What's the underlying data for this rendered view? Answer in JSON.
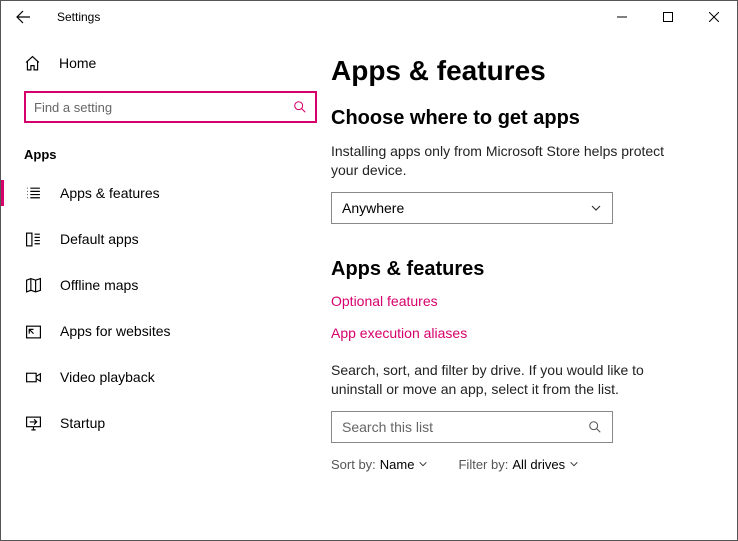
{
  "titlebar": {
    "title": "Settings"
  },
  "sidebar": {
    "home_label": "Home",
    "search_placeholder": "Find a setting",
    "group_label": "Apps",
    "items": [
      {
        "label": "Apps & features"
      },
      {
        "label": "Default apps"
      },
      {
        "label": "Offline maps"
      },
      {
        "label": "Apps for websites"
      },
      {
        "label": "Video playback"
      },
      {
        "label": "Startup"
      }
    ]
  },
  "main": {
    "heading": "Apps & features",
    "section1_title": "Choose where to get apps",
    "section1_desc": "Installing apps only from Microsoft Store helps protect your device.",
    "section1_value": "Anywhere",
    "section2_title": "Apps & features",
    "link_optional": "Optional features",
    "link_aliases": "App execution aliases",
    "list_desc": "Search, sort, and filter by drive. If you would like to uninstall or move an app, select it from the list.",
    "list_search_placeholder": "Search this list",
    "sort_label": "Sort by:",
    "sort_value": "Name",
    "filter_label": "Filter by:",
    "filter_value": "All drives"
  }
}
